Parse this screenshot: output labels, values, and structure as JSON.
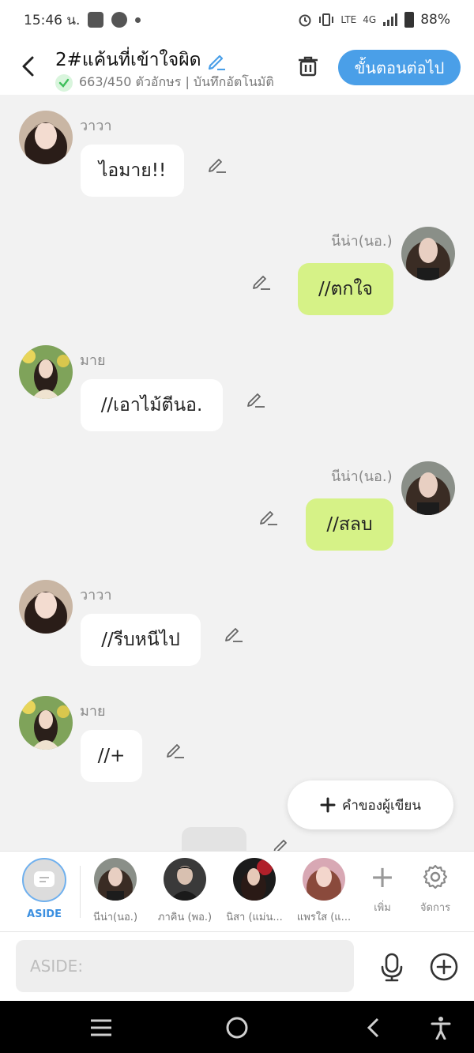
{
  "status": {
    "time": "15:46 น.",
    "network_lte": "LTE",
    "network_4g": "4G",
    "battery": "88%"
  },
  "header": {
    "title": "2#แค้นที่เข้าใจผิด",
    "subtitle": "663/450 ตัวอักษร | บันทึกอัตโนมัติ",
    "next_label": "ขั้นตอนต่อไป"
  },
  "messages": [
    {
      "side": "left",
      "name": "วาวา",
      "text": "ไอมาย!!",
      "avatar": "girl-dark-hair"
    },
    {
      "side": "right",
      "name": "นีน่า(นอ.)",
      "text": "//ตกใจ",
      "avatar": "girl-long-hair"
    },
    {
      "side": "left",
      "name": "มาย",
      "text": "//เอาไม้ตีนอ.",
      "avatar": "girl-garden"
    },
    {
      "side": "right",
      "name": "นีน่า(นอ.)",
      "text": "//สลบ",
      "avatar": "girl-long-hair"
    },
    {
      "side": "left",
      "name": "วาวา",
      "text": "//รีบหนีไป",
      "avatar": "girl-dark-hair"
    },
    {
      "side": "left",
      "name": "มาย",
      "text": "//+",
      "avatar": "girl-garden"
    }
  ],
  "fab_label": "คำของผู้เขียน",
  "characters": {
    "aside_label": "ASIDE",
    "items": [
      {
        "label": "นีน่า(นอ.)"
      },
      {
        "label": "ภาคิน (พอ.)"
      },
      {
        "label": "นิสา (แม่น..."
      },
      {
        "label": "แพรใส (แ..."
      }
    ],
    "add_label": "เพิ่ม",
    "manage_label": "จัดการ"
  },
  "input": {
    "placeholder": "ASIDE:"
  },
  "colors": {
    "accent": "#4a9fe8",
    "right_bubble": "#d6f287",
    "left_bubble": "#ffffff",
    "chat_bg": "#f2f2f2"
  }
}
